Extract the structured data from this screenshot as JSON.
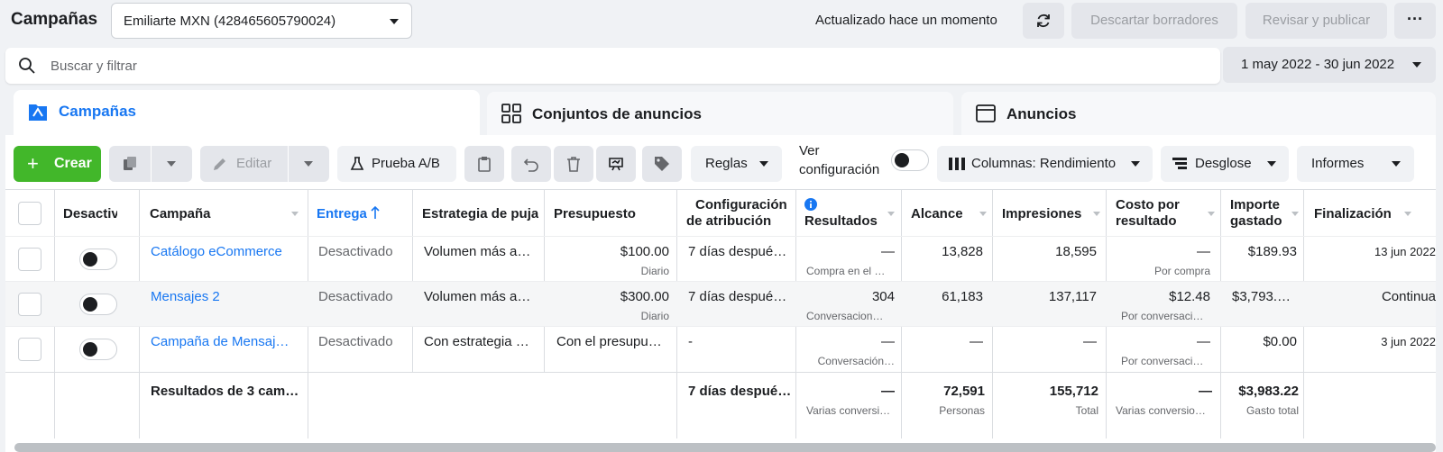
{
  "header": {
    "title": "Campañas",
    "account": "Emiliarte MXN (428465605790024)",
    "updated": "Actualizado hace un momento",
    "discard_label": "Descartar borradores",
    "publish_label": "Revisar y publicar",
    "more_label": "···"
  },
  "search": {
    "placeholder": "Buscar y filtrar",
    "date_range": "1 may 2022 - 30 jun 2022"
  },
  "tabs": [
    {
      "label": "Campañas",
      "active": true
    },
    {
      "label": "Conjuntos de anuncios",
      "active": false
    },
    {
      "label": "Anuncios",
      "active": false
    }
  ],
  "toolbar": {
    "create_label": "Crear",
    "edit_label": "Editar",
    "ab_label": "Prueba A/B",
    "rules_label": "Reglas",
    "ver_label_1": "Ver",
    "ver_label_2": "configuración",
    "columns_label": "Columnas: Rendimiento",
    "breakdown_label": "Desglose",
    "reports_label": "Informes"
  },
  "columns": {
    "off": "Desactiv",
    "campaign": "Campaña",
    "delivery": "Entrega",
    "bid": "Estrategia de puja",
    "budget": "Presupuesto",
    "attr_1": "Configuración",
    "attr_2": "de atribución",
    "results": "Resultados",
    "reach": "Alcance",
    "impressions": "Impresiones",
    "cpr_1": "Costo por",
    "cpr_2": "resultado",
    "spent_1": "Importe",
    "spent_2": "gastado",
    "end": "Finalización"
  },
  "rows": [
    {
      "campaign": "Catálogo eCommerce",
      "delivery": "Desactivado",
      "bid": "Volumen más a…",
      "budget": "$100.00",
      "budget_sub": "Diario",
      "attribution": "7 días despué…",
      "results": "—",
      "results_sub": "Compra en el …",
      "reach": "13,828",
      "impressions": "18,595",
      "cpr": "—",
      "cpr_sub": "Por compra",
      "spent": "$189.93",
      "end": "13 jun 2022"
    },
    {
      "campaign": "Mensajes 2",
      "delivery": "Desactivado",
      "bid": "Volumen más a…",
      "budget": "$300.00",
      "budget_sub": "Diario",
      "attribution": "7 días despué…",
      "results": "304",
      "results_sub": "Conversacion…",
      "reach": "61,183",
      "impressions": "137,117",
      "cpr": "$12.48",
      "cpr_sub": "Por conversaci…",
      "spent": "$3,793.…",
      "end": "Continua"
    },
    {
      "campaign": "Campaña de Mensaj…",
      "delivery": "Desactivado",
      "bid": "Con estrategia …",
      "budget": "Con el presupu…",
      "budget_sub": "",
      "attribution": "-",
      "results": "—",
      "results_sub": "Conversación…",
      "reach": "—",
      "impressions": "—",
      "cpr": "—",
      "cpr_sub": "Por conversaci…",
      "spent": "$0.00",
      "end": "3 jun 2022"
    }
  ],
  "totals": {
    "label": "Resultados de 3 camp…",
    "attribution": "7 días despué…",
    "results": "—",
    "results_sub": "Varias conversi…",
    "reach": "72,591",
    "reach_sub": "Personas",
    "impressions": "155,712",
    "impressions_sub": "Total",
    "cpr": "—",
    "cpr_sub": "Varias conversio…",
    "spent": "$3,983.22",
    "spent_sub": "Gasto total"
  },
  "colors": {
    "accent": "#1877f2",
    "create": "#42b72a"
  }
}
